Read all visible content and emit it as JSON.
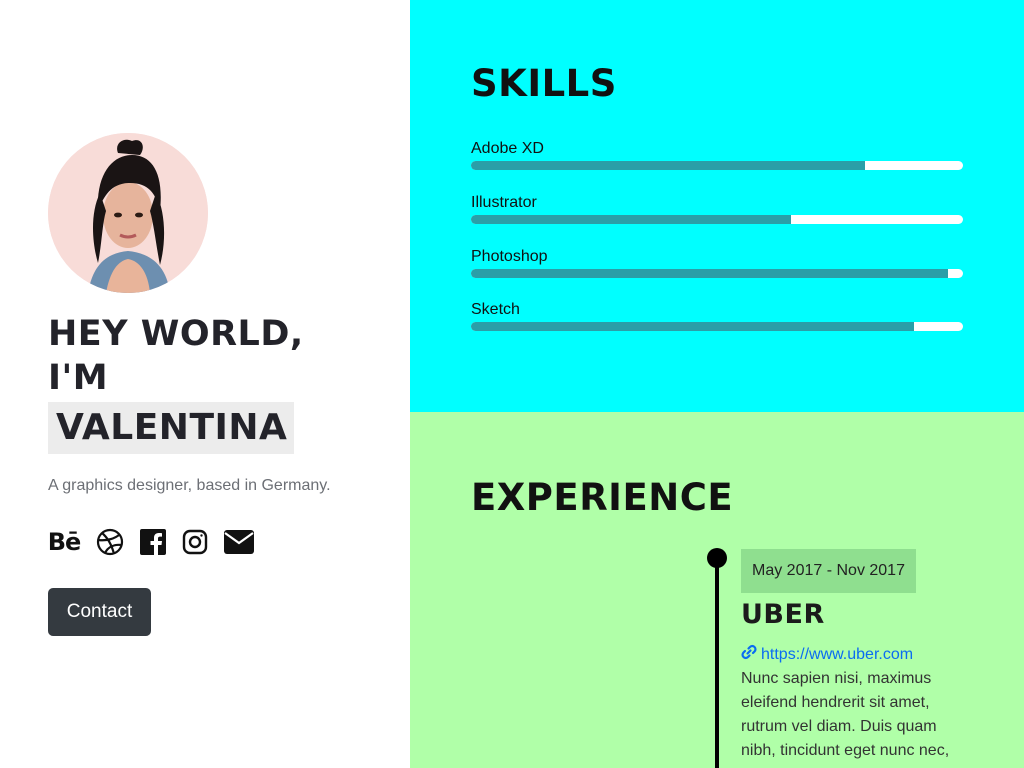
{
  "profile": {
    "hero_line1": "HEY WORLD,",
    "hero_line2": "I'M",
    "hero_name": "VALENTINA",
    "tagline": "A graphics designer, based in Germany.",
    "contact_label": "Contact",
    "socials": [
      {
        "icon": "behance-icon",
        "text": "Bē"
      },
      {
        "icon": "dribbble-icon"
      },
      {
        "icon": "facebook-icon"
      },
      {
        "icon": "instagram-icon"
      },
      {
        "icon": "envelope-icon"
      }
    ]
  },
  "skills": {
    "title": "SKILLS",
    "items": [
      {
        "label": "Adobe XD",
        "level": 0.8
      },
      {
        "label": "Illustrator",
        "level": 0.65
      },
      {
        "label": "Photoshop",
        "level": 0.97
      },
      {
        "label": "Sketch",
        "level": 0.9
      }
    ]
  },
  "experience": {
    "title": "EXPERIENCE",
    "entries": [
      {
        "date": "May 2017 - Nov 2017",
        "company": "UBER",
        "url": "https://www.uber.com",
        "description": "Nunc sapien nisi, maximus eleifend hendrerit sit amet, rutrum vel diam. Duis quam nibh, tincidunt eget nunc nec,"
      }
    ]
  },
  "colors": {
    "skills_bg": "#00ffff",
    "experience_bg": "#b0ffa8",
    "bar_fill": "#2a9fa8",
    "button_bg": "#343a40",
    "link": "#0a6cf2"
  }
}
